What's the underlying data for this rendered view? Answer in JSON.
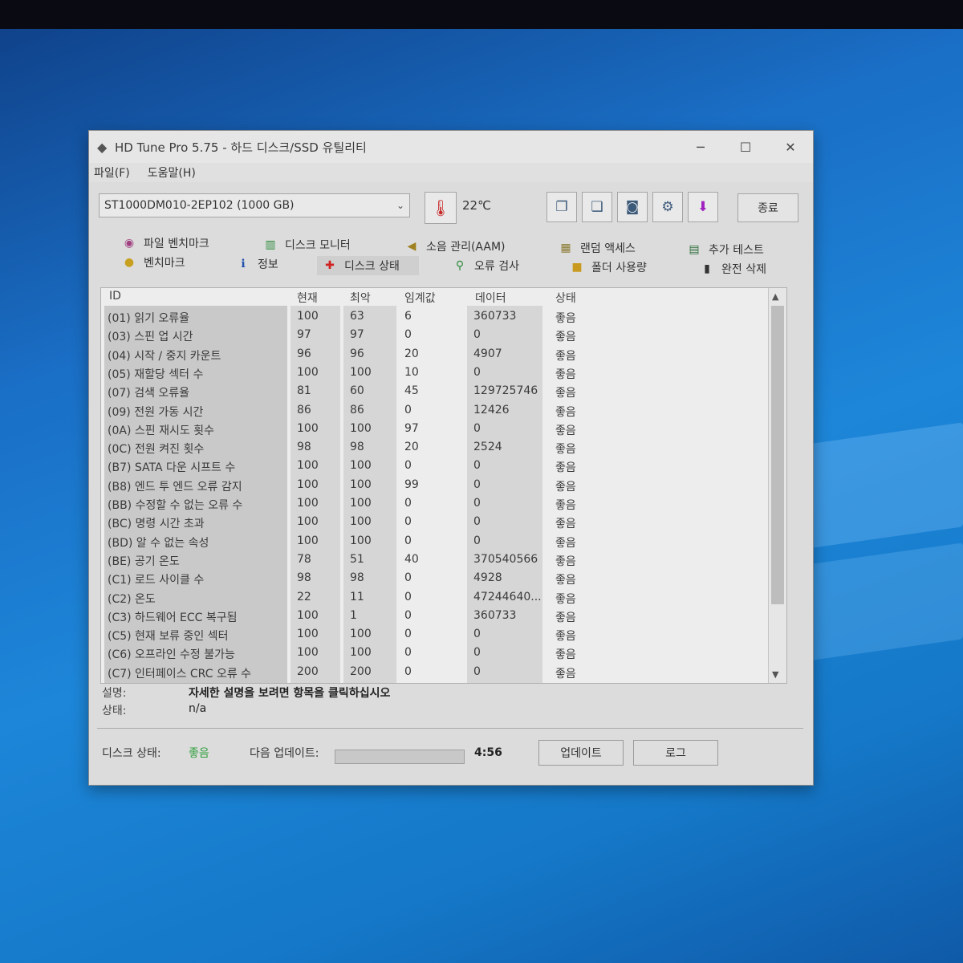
{
  "window": {
    "title": "HD Tune Pro 5.75 - 하드 디스크/SSD 유틸리티",
    "minimize": "─",
    "maximize": "☐",
    "close": "✕"
  },
  "menu": {
    "file": "파일(F)",
    "help": "도움말(H)"
  },
  "toolbar": {
    "drive": "ST1000DM010-2EP102 (1000 GB)",
    "temperature": "22℃",
    "exit_label": "종료"
  },
  "tabs": {
    "file_benchmark": "파일 벤치마크",
    "disk_monitor": "디스크 모니터",
    "aam": "소음 관리(AAM)",
    "random_access": "랜덤 액세스",
    "extra_tests": "추가 테스트",
    "benchmark": "벤치마크",
    "info": "정보",
    "health": "디스크 상태",
    "error_scan": "오류 검사",
    "folder_usage": "폴더 사용량",
    "erase": "완전 삭제"
  },
  "table": {
    "headers": [
      "ID",
      "현재",
      "최악",
      "임계값",
      "데이터",
      "상태"
    ],
    "rows": [
      [
        "(01) 읽기 오류율",
        "100",
        "63",
        "6",
        "360733",
        "좋음"
      ],
      [
        "(03) 스핀 업 시간",
        "97",
        "97",
        "0",
        "0",
        "좋음"
      ],
      [
        "(04) 시작 / 중지 카운트",
        "96",
        "96",
        "20",
        "4907",
        "좋음"
      ],
      [
        "(05) 재할당 섹터 수",
        "100",
        "100",
        "10",
        "0",
        "좋음"
      ],
      [
        "(07) 검색 오류율",
        "81",
        "60",
        "45",
        "129725746",
        "좋음"
      ],
      [
        "(09) 전원 가동 시간",
        "86",
        "86",
        "0",
        "12426",
        "좋음"
      ],
      [
        "(0A) 스핀 재시도 횟수",
        "100",
        "100",
        "97",
        "0",
        "좋음"
      ],
      [
        "(0C) 전원 켜진 횟수",
        "98",
        "98",
        "20",
        "2524",
        "좋음"
      ],
      [
        "(B7) SATA 다운 시프트 수",
        "100",
        "100",
        "0",
        "0",
        "좋음"
      ],
      [
        "(B8) 엔드 투 엔드 오류 감지",
        "100",
        "100",
        "99",
        "0",
        "좋음"
      ],
      [
        "(BB) 수정할 수 없는 오류 수",
        "100",
        "100",
        "0",
        "0",
        "좋음"
      ],
      [
        "(BC) 명령 시간 초과",
        "100",
        "100",
        "0",
        "0",
        "좋음"
      ],
      [
        "(BD) 알 수 없는 속성",
        "100",
        "100",
        "0",
        "0",
        "좋음"
      ],
      [
        "(BE) 공기 온도",
        "78",
        "51",
        "40",
        "370540566",
        "좋음"
      ],
      [
        "(C1) 로드 사이클 수",
        "98",
        "98",
        "0",
        "4928",
        "좋음"
      ],
      [
        "(C2) 온도",
        "22",
        "11",
        "0",
        "47244640...",
        "좋음"
      ],
      [
        "(C3) 하드웨어 ECC 복구됨",
        "100",
        "1",
        "0",
        "360733",
        "좋음"
      ],
      [
        "(C5) 현재 보류 중인 섹터",
        "100",
        "100",
        "0",
        "0",
        "좋음"
      ],
      [
        "(C6) 오프라인 수정 불가능",
        "100",
        "100",
        "0",
        "0",
        "좋음"
      ],
      [
        "(C7) 인터페이스 CRC 오류 수",
        "200",
        "200",
        "0",
        "0",
        "좋음"
      ]
    ]
  },
  "description": {
    "desc_label": "설명:",
    "desc_value": "자세한 설명을 보려면 항목을 클릭하십시오",
    "state_label": "상태:",
    "state_value": "n/a"
  },
  "status": {
    "disk_label": "디스크 상태:",
    "disk_value": "좋음",
    "next_update_label": "다음 업데이트:",
    "time": "4:56",
    "update_btn": "업데이트",
    "log_btn": "로그"
  },
  "colors": {
    "good": "#2e9e3a",
    "desktop": "#1a6fc6"
  }
}
